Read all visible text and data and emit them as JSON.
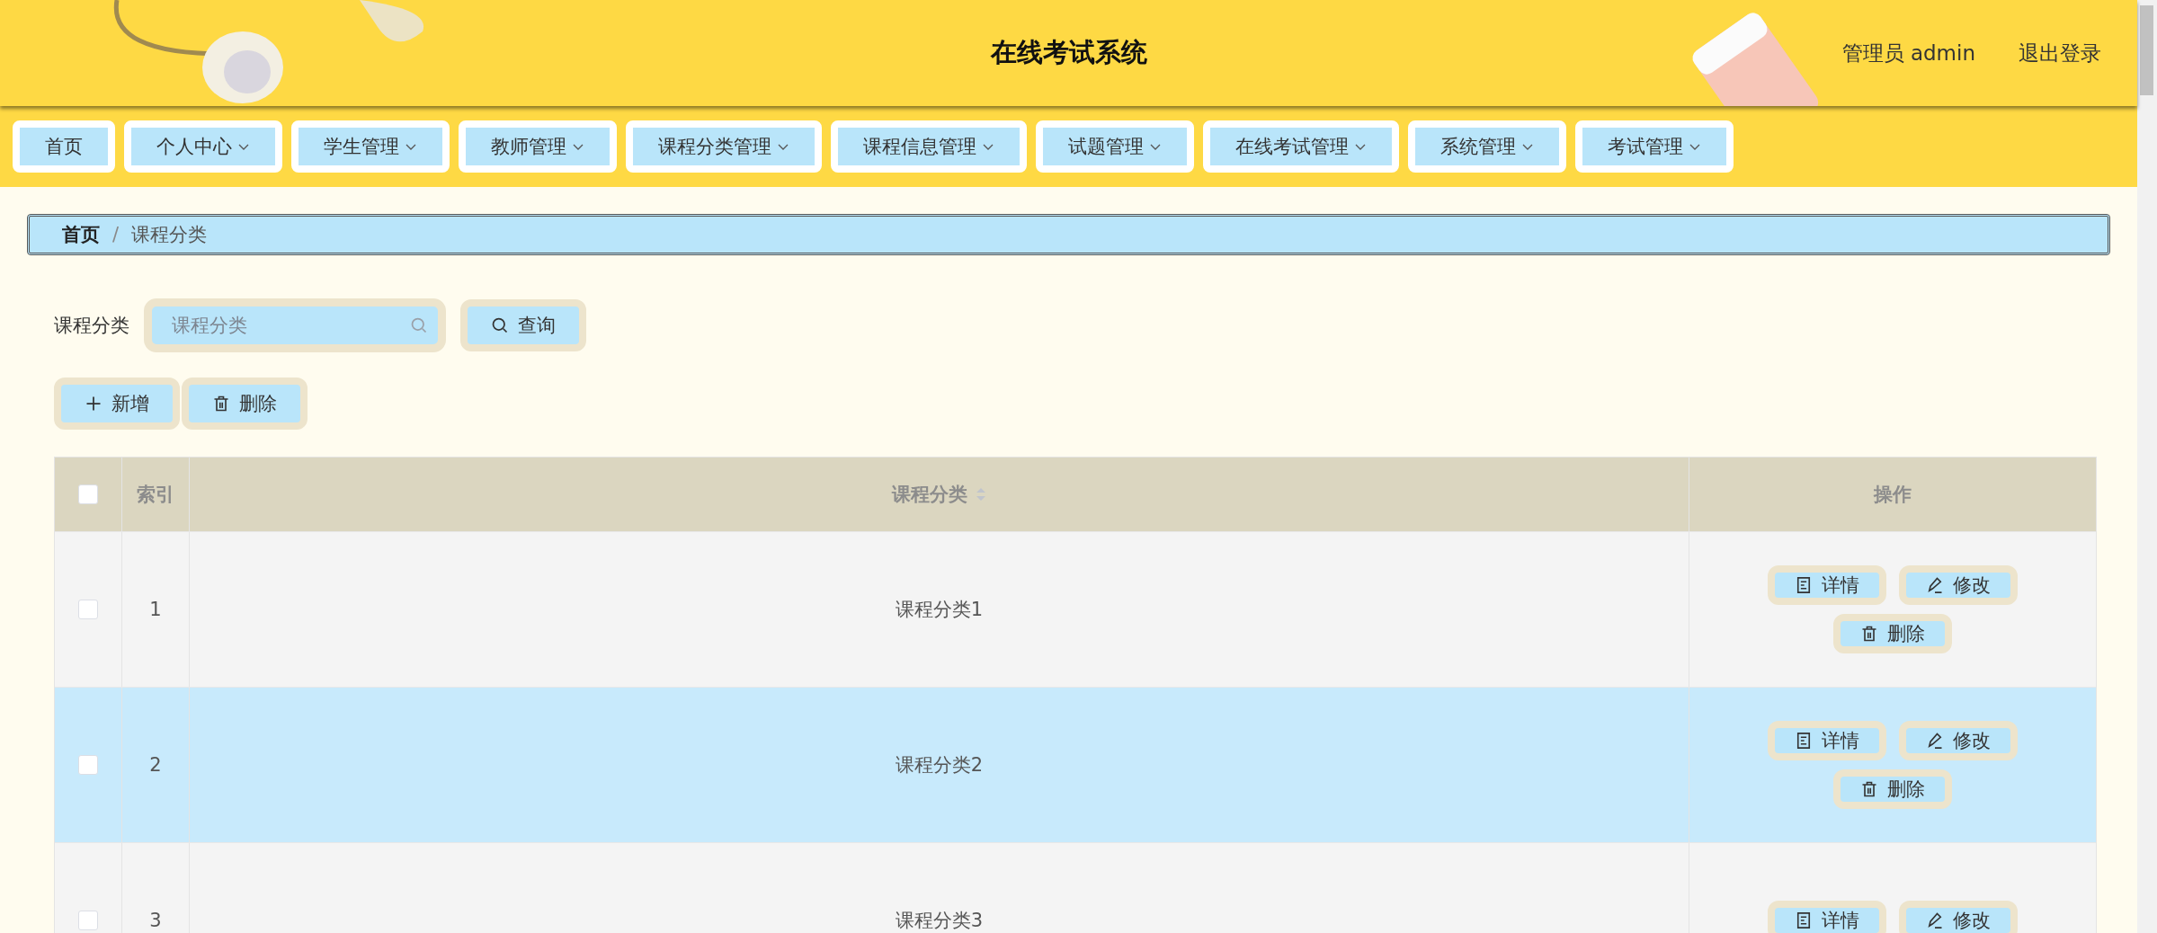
{
  "header": {
    "title": "在线考试系统",
    "user": "管理员 admin",
    "logout": "退出登录"
  },
  "nav": [
    {
      "label": "首页",
      "dropdown": false
    },
    {
      "label": "个人中心",
      "dropdown": true
    },
    {
      "label": "学生管理",
      "dropdown": true
    },
    {
      "label": "教师管理",
      "dropdown": true
    },
    {
      "label": "课程分类管理",
      "dropdown": true
    },
    {
      "label": "课程信息管理",
      "dropdown": true
    },
    {
      "label": "试题管理",
      "dropdown": true
    },
    {
      "label": "在线考试管理",
      "dropdown": true
    },
    {
      "label": "系统管理",
      "dropdown": true
    },
    {
      "label": "考试管理",
      "dropdown": true
    }
  ],
  "breadcrumb": [
    "首页",
    "课程分类"
  ],
  "breadcrumb_separator": "/",
  "search": {
    "label": "课程分类",
    "placeholder": "课程分类",
    "button": "查询"
  },
  "actions": [
    "新增",
    "删除"
  ],
  "table": {
    "columns": [
      "索引",
      "课程分类",
      "操作"
    ],
    "header_checked": false,
    "rows": [
      {
        "index": "1",
        "name": "课程分类1",
        "checked": false,
        "selected": false,
        "buttons": [
          "详情",
          "修改",
          "删除"
        ]
      },
      {
        "index": "2",
        "name": "课程分类2",
        "checked": false,
        "selected": true,
        "buttons": [
          "详情",
          "修改",
          "删除"
        ]
      },
      {
        "index": "3",
        "name": "课程分类3",
        "checked": false,
        "selected": false,
        "buttons": [
          "详情",
          "修改"
        ]
      }
    ]
  }
}
